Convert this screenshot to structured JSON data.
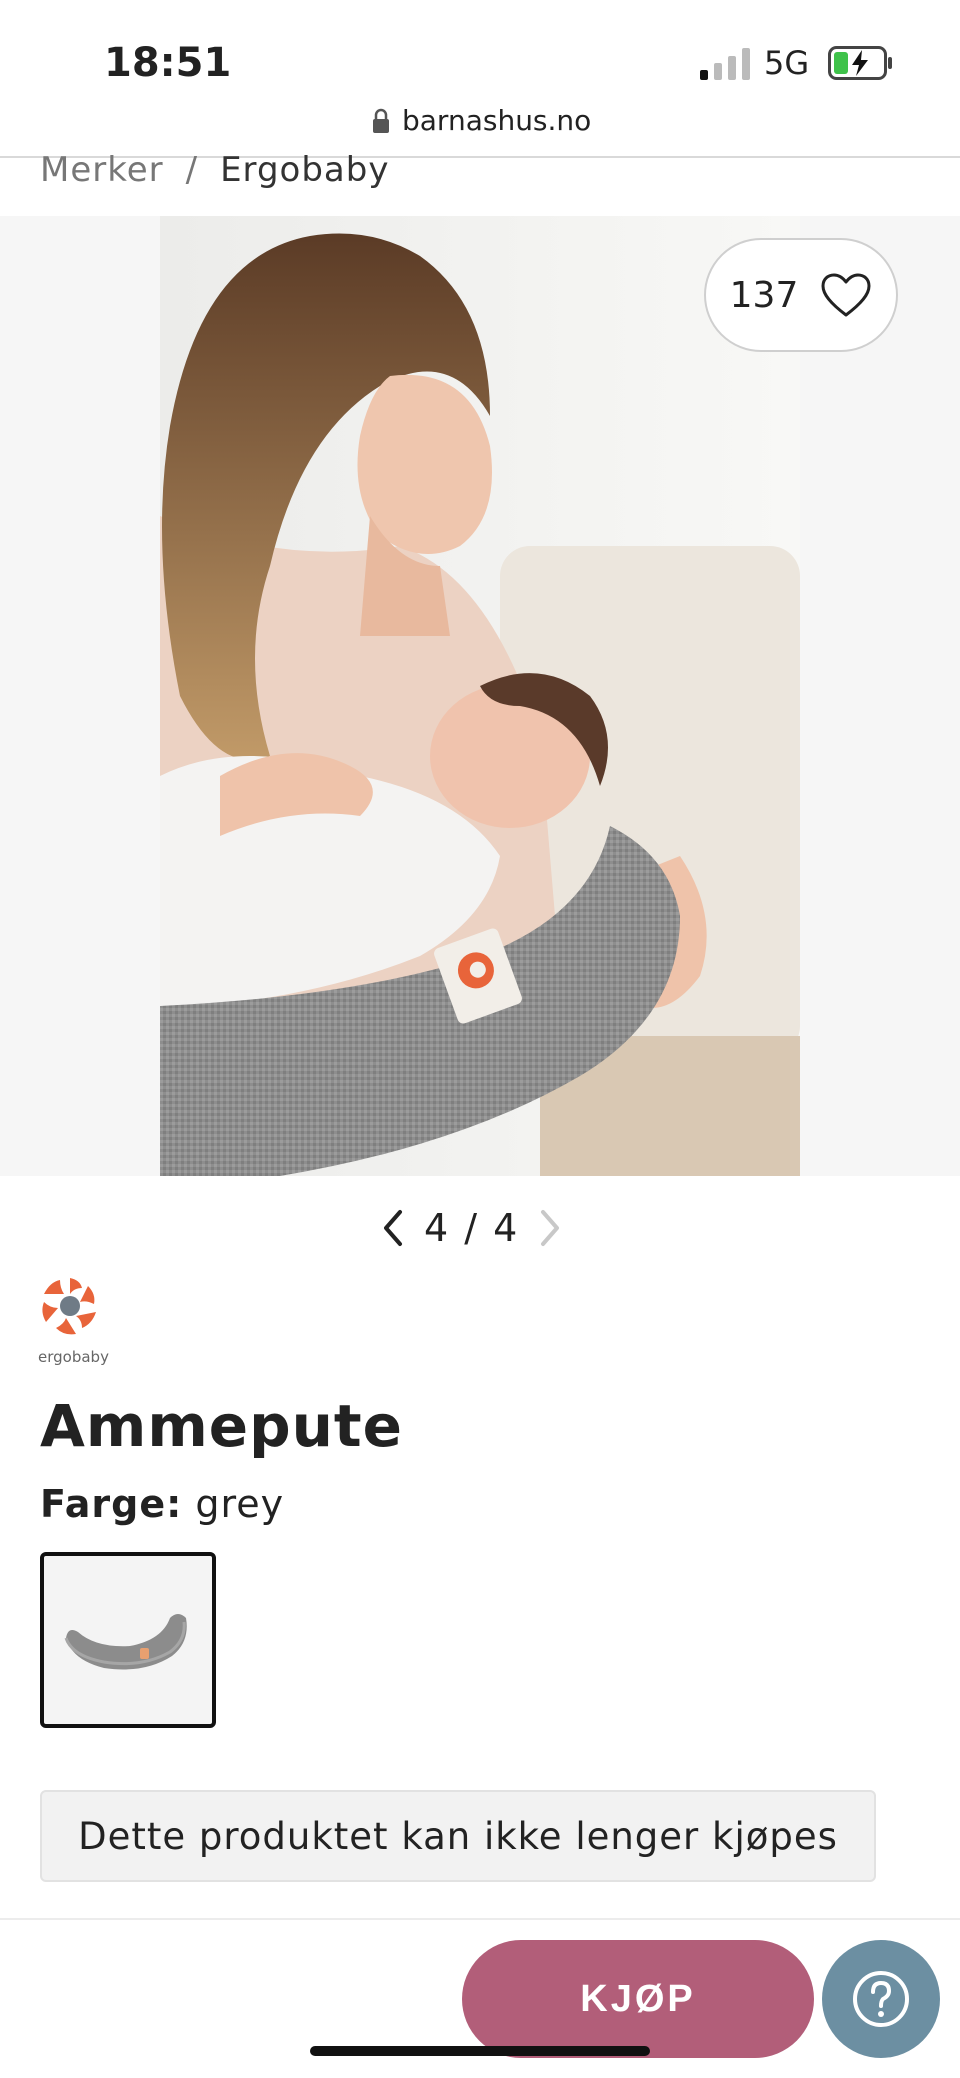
{
  "status_bar": {
    "time": "18:51",
    "network": "5G",
    "icons": [
      "signal-icon",
      "battery-charging-icon"
    ]
  },
  "browser": {
    "url": "barnashus.no",
    "icon": "lock-icon"
  },
  "breadcrumb": {
    "items": [
      "Merker",
      "Ergobaby"
    ],
    "separator": "/"
  },
  "gallery": {
    "likes": "137",
    "like_icon": "heart-icon",
    "current": "4",
    "total": "4",
    "pager_text": "4 / 4"
  },
  "brand": {
    "name": "ergobaby",
    "accent_color": "#e8643a"
  },
  "product": {
    "title": "Ammepute",
    "color_label": "Farge:",
    "color_value": "grey"
  },
  "notice": "Dette produktet kan ikke lenger kjøpes",
  "actions": {
    "buy_label": "KJØP",
    "buy_color": "#b25e79",
    "help_icon": "question-mark-icon",
    "help_color": "#6c8fa2"
  }
}
